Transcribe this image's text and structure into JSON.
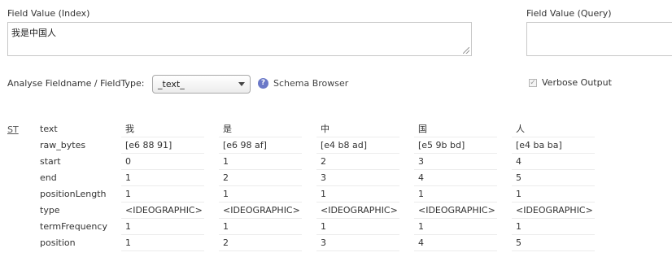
{
  "index_field": {
    "label": "Field Value (Index)",
    "value": "我是中国人"
  },
  "query_field": {
    "label": "Field Value (Query)",
    "value": ""
  },
  "analyse": {
    "label": "Analyse Fieldname / FieldType:",
    "selected": "_text_",
    "schema_browser": "Schema Browser",
    "help_glyph": "?",
    "verbose_label": "Verbose Output",
    "verbose_checked": true
  },
  "results": {
    "stage": "ST",
    "row_labels": [
      "text",
      "raw_bytes",
      "start",
      "end",
      "positionLength",
      "type",
      "termFrequency",
      "position"
    ],
    "tokens": [
      [
        "我",
        "[e6 88 91]",
        "0",
        "1",
        "1",
        "<IDEOGRAPHIC>",
        "1",
        "1"
      ],
      [
        "是",
        "[e6 98 af]",
        "1",
        "2",
        "1",
        "<IDEOGRAPHIC>",
        "1",
        "2"
      ],
      [
        "中",
        "[e4 b8 ad]",
        "2",
        "3",
        "1",
        "<IDEOGRAPHIC>",
        "1",
        "3"
      ],
      [
        "国",
        "[e5 9b bd]",
        "3",
        "4",
        "1",
        "<IDEOGRAPHIC>",
        "1",
        "4"
      ],
      [
        "人",
        "[e4 ba ba]",
        "4",
        "5",
        "1",
        "<IDEOGRAPHIC>",
        "1",
        "5"
      ]
    ]
  }
}
